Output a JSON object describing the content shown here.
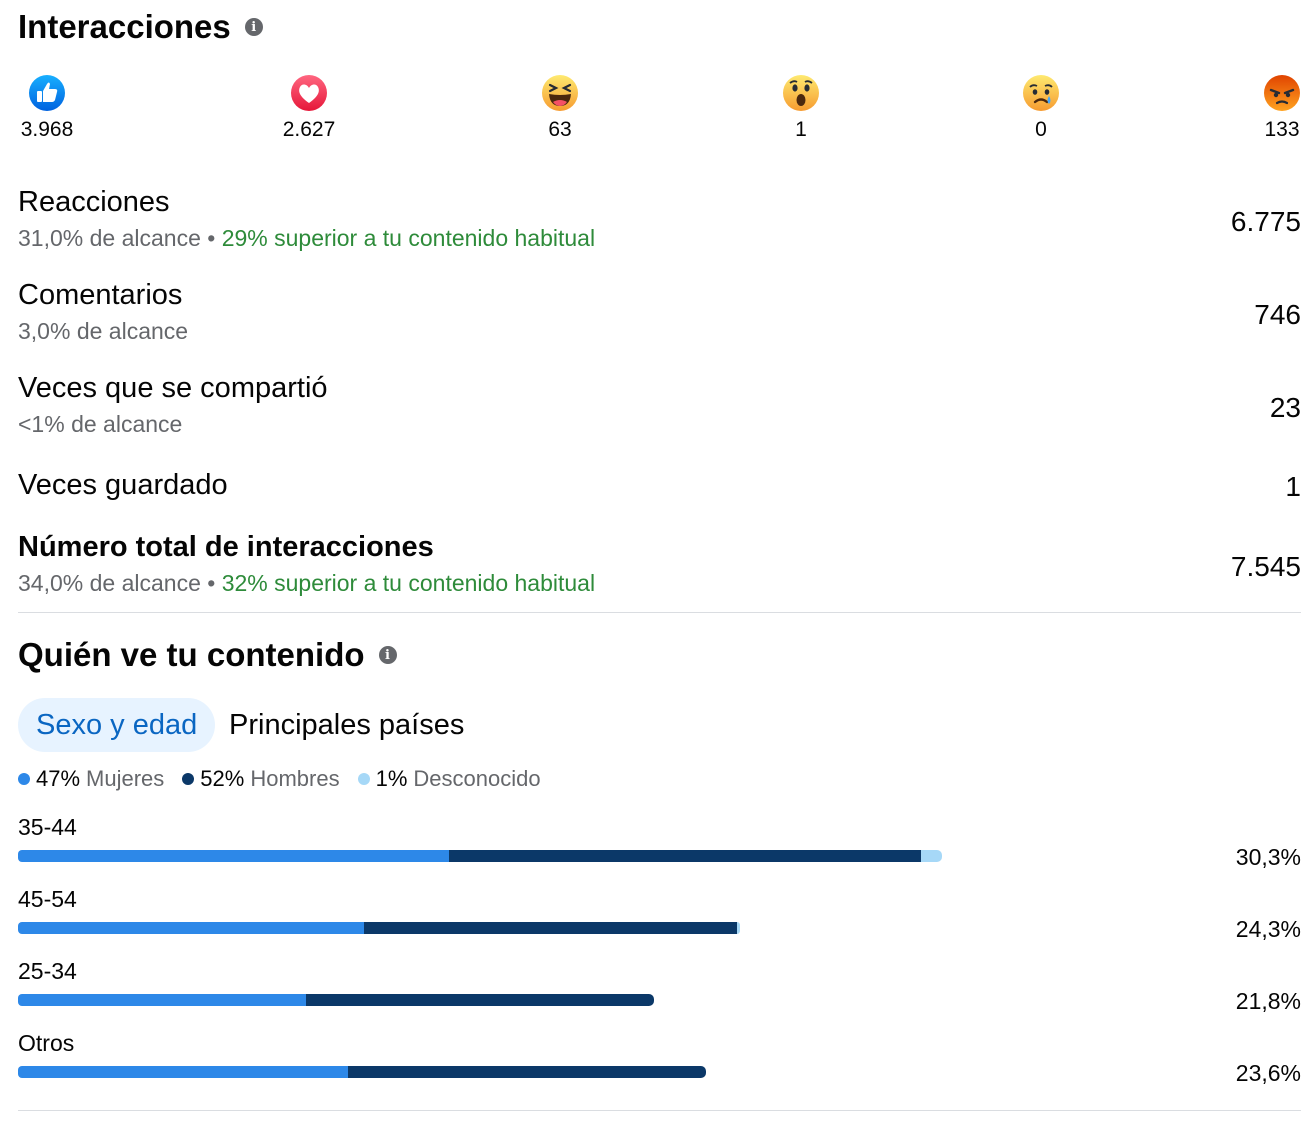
{
  "interactions": {
    "title": "Interacciones",
    "info_icon": "info-icon",
    "reactions": [
      {
        "name": "like",
        "icon": "like-icon",
        "count": "3.968"
      },
      {
        "name": "love",
        "icon": "love-icon",
        "count": "2.627"
      },
      {
        "name": "haha",
        "icon": "haha-icon",
        "count": "63"
      },
      {
        "name": "wow",
        "icon": "wow-icon",
        "count": "1"
      },
      {
        "name": "sad",
        "icon": "sad-icon",
        "count": "0"
      },
      {
        "name": "angry",
        "icon": "angry-icon",
        "count": "133"
      }
    ],
    "metrics": [
      {
        "name": "Reacciones",
        "sub": "31,0% de alcance",
        "separator": "•",
        "highlight": "29% superior a tu contenido habitual",
        "value": "6.775"
      },
      {
        "name": "Comentarios",
        "sub": "3,0% de alcance",
        "value": "746"
      },
      {
        "name": "Veces que se compartió",
        "sub": "<1% de alcance",
        "value": "23"
      },
      {
        "name": "Veces guardado",
        "value": "1"
      },
      {
        "name": "Número total de interacciones",
        "sub": "34,0% de alcance",
        "separator": "•",
        "highlight": "32% superior a tu contenido habitual",
        "value": "7.545"
      }
    ]
  },
  "audience": {
    "title": "Quién ve tu contenido",
    "tabs": [
      {
        "label": "Sexo y edad",
        "active": true
      },
      {
        "label": "Principales países",
        "active": false
      }
    ],
    "legend": [
      {
        "pct": "47%",
        "label": "Mujeres",
        "color": "#2d88e8"
      },
      {
        "pct": "52%",
        "label": "Hombres",
        "color": "#0b3868"
      },
      {
        "pct": "1%",
        "label": "Desconocido",
        "color": "#a6d8f7"
      }
    ],
    "age_groups": [
      {
        "label": "35-44",
        "pct": "30,3%",
        "women": 14.1,
        "men": 15.4,
        "unknown": 0.7
      },
      {
        "label": "45-54",
        "pct": "24,3%",
        "women": 11.3,
        "men": 12.2,
        "unknown": 0.1
      },
      {
        "label": "25-34",
        "pct": "21,8%",
        "women": 9.4,
        "men": 11.4,
        "unknown": 0.0
      },
      {
        "label": "Otros",
        "pct": "23,6%",
        "women": 10.8,
        "men": 11.7,
        "unknown": 0.0
      }
    ]
  }
}
